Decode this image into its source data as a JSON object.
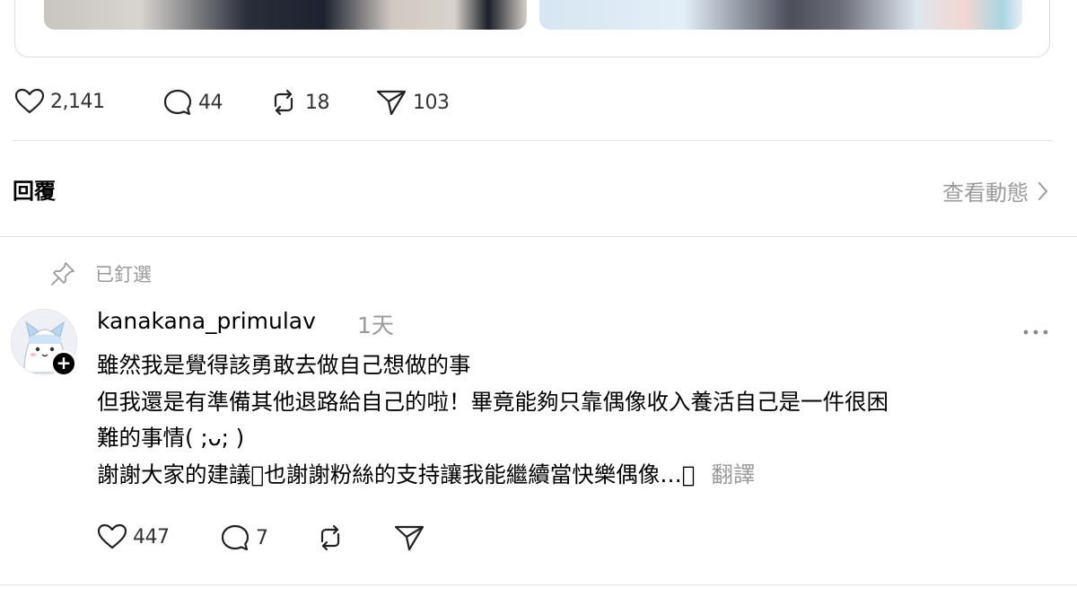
{
  "post": {
    "likes": "2,141",
    "comments": "44",
    "reposts": "18",
    "shares": "103"
  },
  "replies_section": {
    "title": "回覆",
    "activity_link": "查看動態"
  },
  "reply": {
    "pinned_label": "已釘選",
    "username": "kanakana_primulav",
    "timestamp": "1天",
    "lines": [
      "雖然我是覺得該勇敢去做自己想做的事",
      "但我還是有準備其他退路給自己的啦！畢竟能夠只靠偶像收入養活自己是一件很困",
      "難的事情( ;ᴗ; )",
      "謝謝大家的建議􀀀也謝謝粉絲的支持讓我能繼續當快樂偶像…􀀀"
    ],
    "translate_label": "翻譯",
    "likes": "447",
    "comments": "7"
  },
  "icons": {
    "like": "heart-icon",
    "comment": "comment-bubble-icon",
    "repost": "repost-icon",
    "share": "send-icon",
    "pin": "pin-icon",
    "more": "more-dots-icon",
    "chevron": "chevron-right-icon"
  }
}
